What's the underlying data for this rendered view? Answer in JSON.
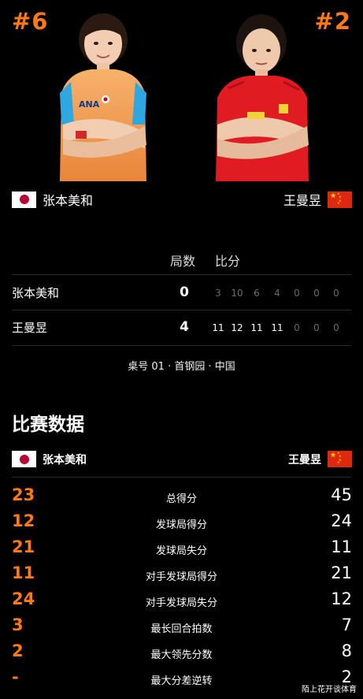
{
  "player1": {
    "rank": "#6",
    "name": "张本美和",
    "flag": "japan-flag"
  },
  "player2": {
    "rank": "#2",
    "name": "王曼昱",
    "flag": "china-flag"
  },
  "score_table": {
    "games_header": "局数",
    "sets_header": "比分",
    "rows": [
      {
        "name": "张本美和",
        "games": "0",
        "sets": [
          "3",
          "10",
          "6",
          "4",
          "0",
          "0",
          "0"
        ]
      },
      {
        "name": "王曼昱",
        "games": "4",
        "sets": [
          "11",
          "12",
          "11",
          "11",
          "0",
          "0",
          "0"
        ]
      }
    ]
  },
  "venue": "桌号 01 · 首钢园 · 中国",
  "stats_title": "比赛数据",
  "stats": [
    {
      "left": "23",
      "label": "总得分",
      "right": "45"
    },
    {
      "left": "12",
      "label": "发球局得分",
      "right": "24"
    },
    {
      "left": "21",
      "label": "发球局失分",
      "right": "11"
    },
    {
      "left": "11",
      "label": "对手发球局得分",
      "right": "21"
    },
    {
      "left": "24",
      "label": "对手发球局失分",
      "right": "12"
    },
    {
      "left": "3",
      "label": "最长回合拍数",
      "right": "7"
    },
    {
      "left": "2",
      "label": "最大领先分数",
      "right": "8"
    },
    {
      "left": "-",
      "label": "最大分差逆转",
      "right": "2"
    }
  ],
  "watermark": "陌上花开谈体育",
  "colors": {
    "accent": "#ff7a12",
    "background": "#000000",
    "winner_text": "#ffffff",
    "loser_set_text": "#6b6b6b"
  }
}
